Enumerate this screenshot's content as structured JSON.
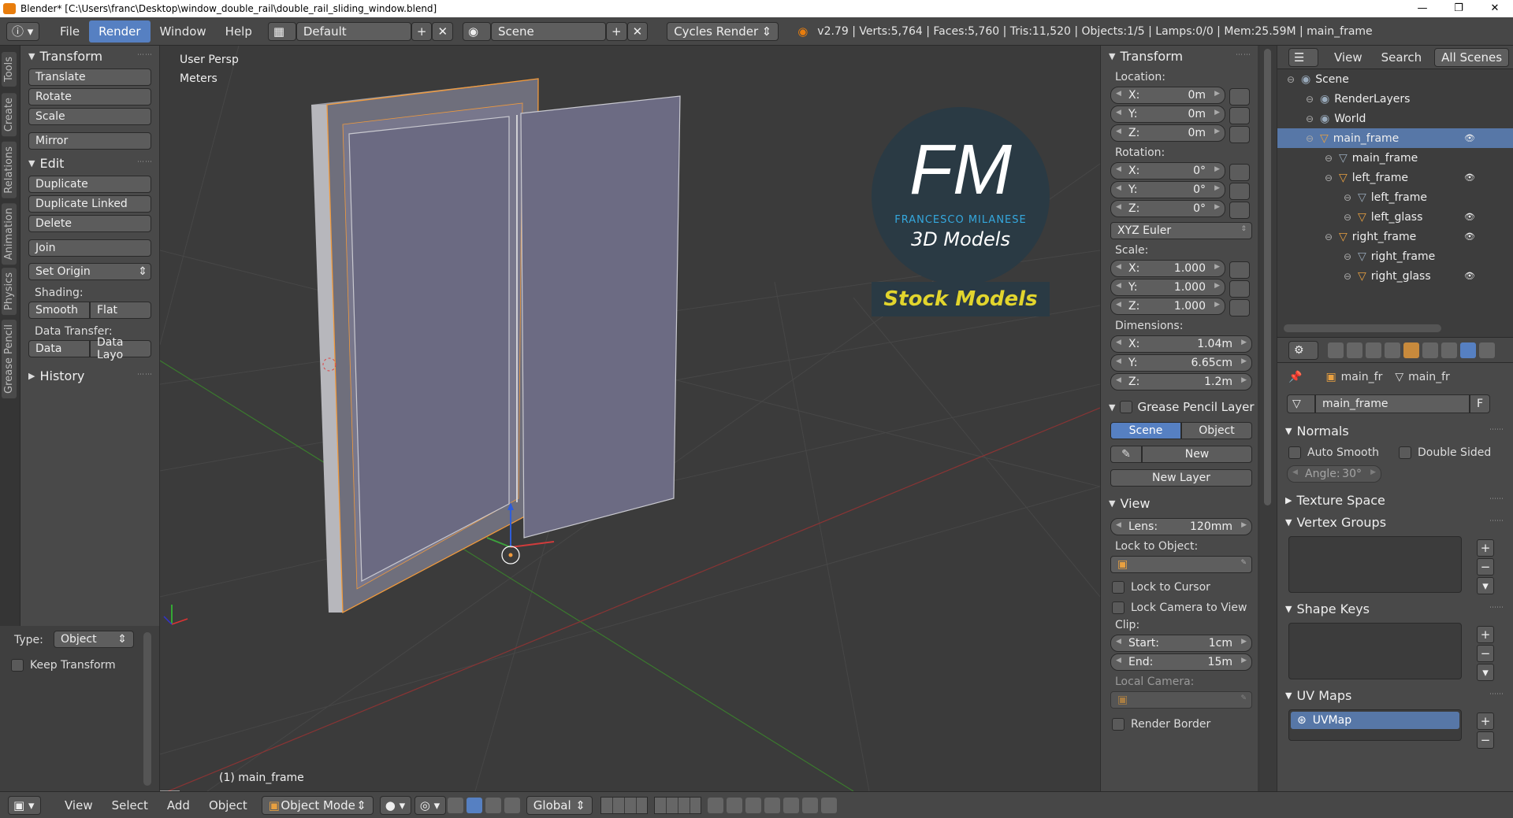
{
  "window": {
    "title": "Blender* [C:\\Users\\franc\\Desktop\\window_double_rail\\double_rail_sliding_window.blend]",
    "controls": [
      "—",
      "❐",
      "✕"
    ]
  },
  "topbar": {
    "menus": [
      "File",
      "Render",
      "Window",
      "Help"
    ],
    "active_menu": "Render",
    "layout": "Default",
    "scene": "Scene",
    "engine": "Cycles Render",
    "stats": "v2.79 | Verts:5,764 | Faces:5,760 | Tris:11,520 | Objects:1/5 | Lamps:0/0 | Mem:25.59M | main_frame"
  },
  "left_tabs": [
    "Tools",
    "Create",
    "Relations",
    "Animation",
    "Physics",
    "Grease Pencil"
  ],
  "toolshelf": {
    "transform": {
      "title": "Transform",
      "buttons": [
        "Translate",
        "Rotate",
        "Scale",
        "Mirror"
      ]
    },
    "edit": {
      "title": "Edit",
      "buttons": [
        "Duplicate",
        "Duplicate Linked",
        "Delete",
        "Join"
      ],
      "set_origin": "Set Origin",
      "shading_label": "Shading:",
      "smooth": "Smooth",
      "flat": "Flat",
      "data_transfer_label": "Data Transfer:",
      "data": "Data",
      "data_layo": "Data Layo"
    },
    "history": "History"
  },
  "operator_panel": {
    "type_label": "Type:",
    "type_value": "Object",
    "keep_transform": "Keep Transform"
  },
  "viewport": {
    "view_label": "User Persp",
    "units": "Meters",
    "object_label": "(1) main_frame",
    "watermark": {
      "logo": "FM",
      "brand": "FRANCESCO MILANESE",
      "models": "3D Models",
      "stock": "Stock Models"
    }
  },
  "npanel": {
    "transform_title": "Transform",
    "location_label": "Location:",
    "location": [
      {
        "k": "X:",
        "v": "0m"
      },
      {
        "k": "Y:",
        "v": "0m"
      },
      {
        "k": "Z:",
        "v": "0m"
      }
    ],
    "rotation_label": "Rotation:",
    "rotation": [
      {
        "k": "X:",
        "v": "0°"
      },
      {
        "k": "Y:",
        "v": "0°"
      },
      {
        "k": "Z:",
        "v": "0°"
      }
    ],
    "rotation_mode": "XYZ Euler",
    "scale_label": "Scale:",
    "scale": [
      {
        "k": "X:",
        "v": "1.000"
      },
      {
        "k": "Y:",
        "v": "1.000"
      },
      {
        "k": "Z:",
        "v": "1.000"
      }
    ],
    "dimensions_label": "Dimensions:",
    "dimensions": [
      {
        "k": "X:",
        "v": "1.04m"
      },
      {
        "k": "Y:",
        "v": "6.65cm"
      },
      {
        "k": "Z:",
        "v": "1.2m"
      }
    ],
    "gp_title": "Grease Pencil Layer",
    "gp_scene": "Scene",
    "gp_object": "Object",
    "gp_new": "New",
    "gp_new_layer": "New Layer",
    "view_title": "View",
    "lens_label": "Lens:",
    "lens_value": "120mm",
    "lock_to_object": "Lock to Object:",
    "lock_cursor": "Lock to Cursor",
    "lock_camera": "Lock Camera to View",
    "clip_label": "Clip:",
    "clip_start_label": "Start:",
    "clip_start": "1cm",
    "clip_end_label": "End:",
    "clip_end": "15m",
    "local_camera": "Local Camera:",
    "render_border": "Render Border"
  },
  "outliner": {
    "tabs": [
      "View",
      "Search",
      "All Scenes"
    ],
    "items": [
      {
        "label": "Scene",
        "indent": 0,
        "icon": "scene-icon"
      },
      {
        "label": "RenderLayers",
        "indent": 1,
        "icon": "renderlayers-icon"
      },
      {
        "label": "World",
        "indent": 1,
        "icon": "world-icon"
      },
      {
        "label": "main_frame",
        "indent": 1,
        "icon": "object-icon",
        "selected": true
      },
      {
        "label": "main_frame",
        "indent": 2,
        "icon": "mesh-icon"
      },
      {
        "label": "left_frame",
        "indent": 2,
        "icon": "object-icon"
      },
      {
        "label": "left_frame",
        "indent": 3,
        "icon": "mesh-icon"
      },
      {
        "label": "left_glass",
        "indent": 3,
        "icon": "object-icon"
      },
      {
        "label": "right_frame",
        "indent": 2,
        "icon": "object-icon"
      },
      {
        "label": "right_frame",
        "indent": 3,
        "icon": "mesh-icon"
      },
      {
        "label": "right_glass",
        "indent": 3,
        "icon": "object-icon"
      }
    ]
  },
  "properties": {
    "breadcrumb1": "main_fr",
    "breadcrumb2": "main_fr",
    "mesh_name": "main_frame",
    "fake_user": "F",
    "normals_title": "Normals",
    "auto_smooth": "Auto Smooth",
    "double_sided": "Double Sided",
    "angle_label": "Angle:",
    "angle_value": "30°",
    "texture_space": "Texture Space",
    "vertex_groups": "Vertex Groups",
    "shape_keys": "Shape Keys",
    "uv_maps": "UV Maps",
    "uvmap": "UVMap"
  },
  "bottombar": {
    "menus": [
      "View",
      "Select",
      "Add",
      "Object"
    ],
    "mode": "Object Mode",
    "orientation": "Global"
  }
}
